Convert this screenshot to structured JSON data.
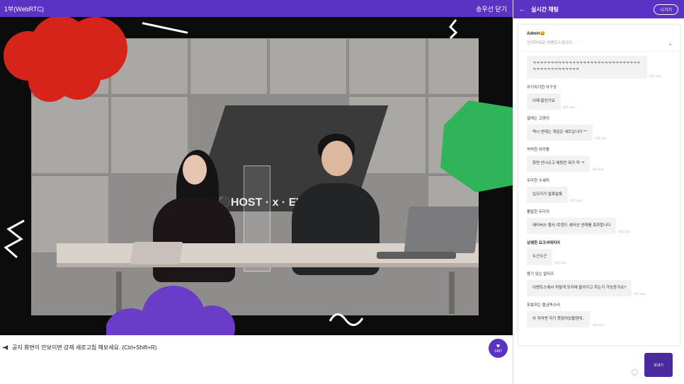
{
  "topbar": {
    "title": "1부(WebRTC)",
    "close_label": "송우선 닫기"
  },
  "notice": {
    "text": "공지  화면이 안보이면 강제 새로고침 해보세요. (Ctrl+Shift+R)"
  },
  "likes": {
    "count": "1497"
  },
  "chat": {
    "header_title": "실시간 채팅",
    "exit_label": "나가기",
    "pinned": {
      "author": "Admin😀",
      "message": "안녕하세요! 이벤트스입니다 · · ·"
    },
    "messages": [
      {
        "nick": "",
        "text": "ㅋㅋㅋㅋㅋㅋㅋㅋㅋㅋㅋㅋㅋㅋㅋㅋㅋㅋㅋㅋㅋㅋㅋㅋㅋㅋㅋㅋㅋㅋㅋㅋㅋㅋㅋㅋㅋㅋㅋㅋㅋㅋㅋ",
        "time": "오후 3:20"
      },
      {
        "nick": "아기자기한 아구공",
        "text": "이제 끝인가요",
        "time": "오후 3:20"
      },
      {
        "nick": "설레는 고양이",
        "text": "역시 넨데는 게임은 세트입니다 ^^",
        "time": "오후 3:20"
      },
      {
        "nick": "씩씩한 아카풍",
        "text": "화면 안나오고 채팅만 뭐가 막 ㅋ",
        "time": "오후 3:20"
      },
      {
        "nick": "우아한 수세미",
        "text": "입꼬리가 씰룩씰룩",
        "time": "오후 3:20"
      },
      {
        "nick": "활발한 두더지",
        "text": "에티버스 행사 /트랜드 섀터상 넨데를 축하합니다",
        "time": "오후 3:20"
      },
      {
        "nick": "상쾌한 요크셔테리어",
        "text": "두근두근",
        "time": "오후 3:20"
      },
      {
        "nick": "용기 있는 말티즈",
        "text": "이벤트스에서 저렇게 모자에 들어가고 하는거 가능한가요?",
        "time": "오후 3:20"
      },
      {
        "nick": "포효하는 황금독수리",
        "text": "아 저러면 저기 못앉아있을텐데..",
        "time": "오후 3:20"
      }
    ],
    "send_label": "보내기"
  },
  "colors": {
    "brand": "#5b33c4",
    "red": "#d6241a",
    "green": "#2fb45a",
    "purple": "#6a3cc7"
  }
}
